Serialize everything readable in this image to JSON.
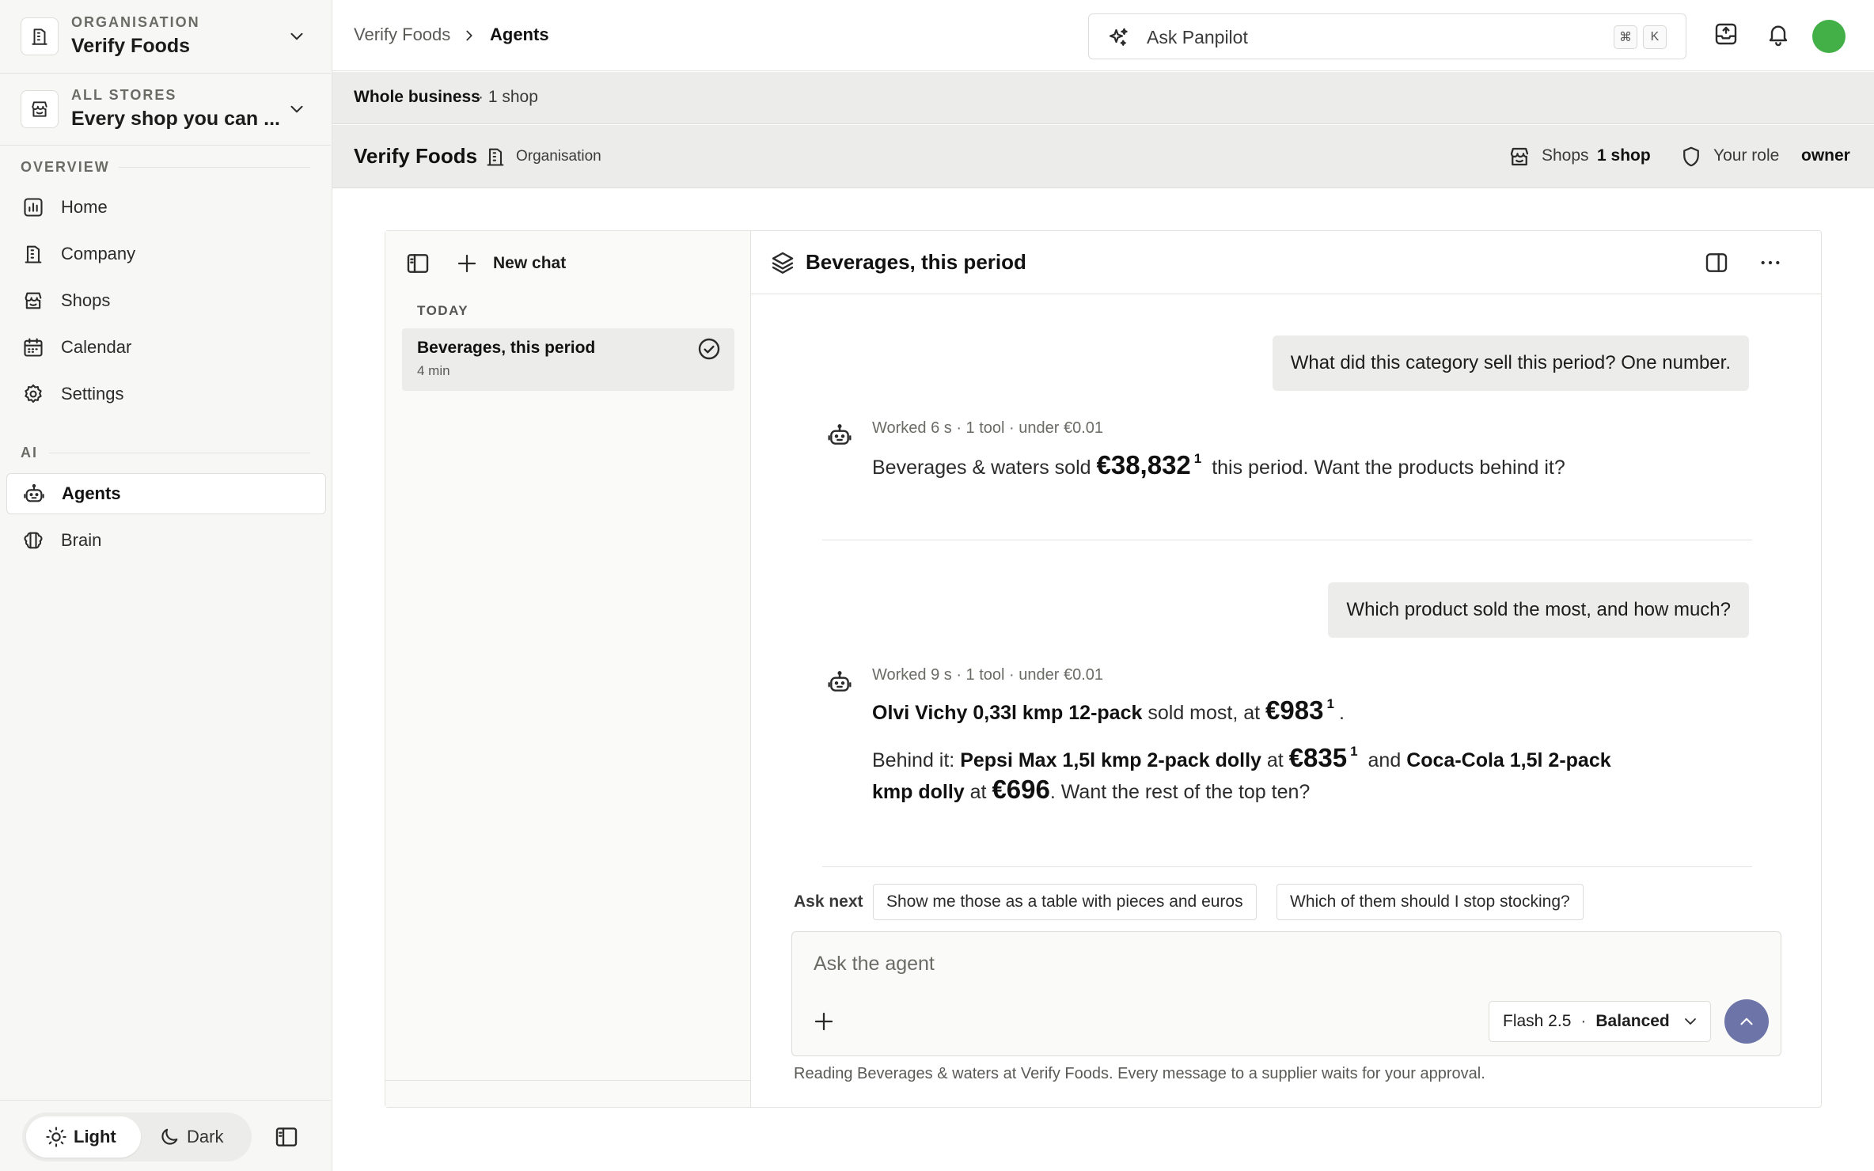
{
  "sidebar": {
    "org_switcher": {
      "label": "ORGANISATION",
      "value": "Verify Foods"
    },
    "store_switcher": {
      "label": "ALL STORES",
      "value": "Every shop you can ..."
    },
    "overview_label": "OVERVIEW",
    "ai_label": "AI",
    "nav": {
      "home": "Home",
      "company": "Company",
      "shops": "Shops",
      "calendar": "Calendar",
      "settings": "Settings",
      "agents": "Agents",
      "brain": "Brain"
    },
    "active_item": "Agents",
    "theme": {
      "light": "Light",
      "dark": "Dark",
      "selected": "Light"
    }
  },
  "topbar": {
    "breadcrumb": [
      "Verify Foods",
      "Agents"
    ],
    "search": {
      "label": "Ask Panpilot",
      "shortcut_keys": [
        "⌘",
        "K"
      ]
    },
    "avatar_color": "#43b047"
  },
  "scope": {
    "title": "Whole business",
    "detail": "· 1 shop"
  },
  "org_header": {
    "name": "Verify Foods",
    "type": "Organisation",
    "shops_label": "Shops",
    "shops_value": "1 shop",
    "role_label": "Your role",
    "role_value": "owner"
  },
  "chat": {
    "new_chat_label": "New chat",
    "history_section": "TODAY",
    "history": [
      {
        "title": "Beverages, this period",
        "age": "4 min",
        "status": "done"
      }
    ],
    "title": "Beverages, this period",
    "messages": {
      "q1": "What did this category sell this period? One number.",
      "a1": {
        "meta": "Worked 6 s · 1 tool · under €0.01",
        "pre": "Beverages & waters sold",
        "value": "€38,832",
        "cite": "1",
        "post": "this period. Want the products behind it?"
      },
      "q2": "Which product sold the most, and how much?",
      "a2": {
        "meta": "Worked 9 s · 1 tool · under €0.01",
        "line1_product": "Olvi Vichy 0,33l kmp 12-pack",
        "line1_mid": "sold most, at",
        "line1_value": "€983",
        "line1_cite": "1",
        "line1_end": ".",
        "line2_pre": "Behind it:",
        "line2_product1": "Pepsi Max 1,5l kmp 2-pack dolly",
        "line2_at1": "at",
        "line2_value1": "€835",
        "line2_cite": "1",
        "line2_and": "and",
        "line2_product2a": "Coca-Cola 1,5l 2-pack",
        "line3_product2b": "kmp dolly",
        "line3_at2": "at",
        "line3_value2": "€696",
        "line3_end": ". Want the rest of the top ten?"
      }
    },
    "ask_next_label": "Ask next",
    "suggestions": [
      "Show me those as a table with pieces and euros",
      "Which of them should I stop stocking?"
    ],
    "composer": {
      "placeholder": "Ask the agent",
      "model": "Flash 2.5",
      "mode": "Balanced",
      "send_color": "#6d74a8"
    },
    "footer_note": "Reading Beverages & waters at Verify Foods. Every message to a supplier waits for your approval."
  }
}
